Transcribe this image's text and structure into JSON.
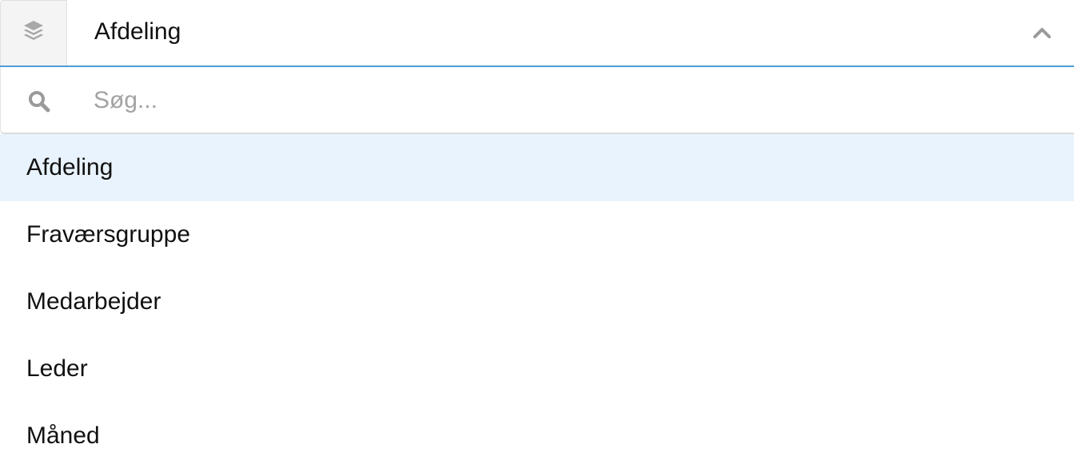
{
  "select": {
    "prefix_icon": "layers-icon",
    "selected_label": "Afdeling",
    "toggle_icon": "chevron-up-icon",
    "accent_color": "#4a9fd6"
  },
  "search": {
    "icon": "search-icon",
    "placeholder": "Søg...",
    "value": ""
  },
  "options": [
    {
      "label": "Afdeling",
      "highlighted": true
    },
    {
      "label": "Fraværsgruppe",
      "highlighted": false
    },
    {
      "label": "Medarbejder",
      "highlighted": false
    },
    {
      "label": "Leder",
      "highlighted": false
    },
    {
      "label": "Måned",
      "highlighted": false
    }
  ],
  "colors": {
    "highlight_bg": "#e9f3fd",
    "icon_gray": "#9a9a9a",
    "text": "#111111"
  }
}
